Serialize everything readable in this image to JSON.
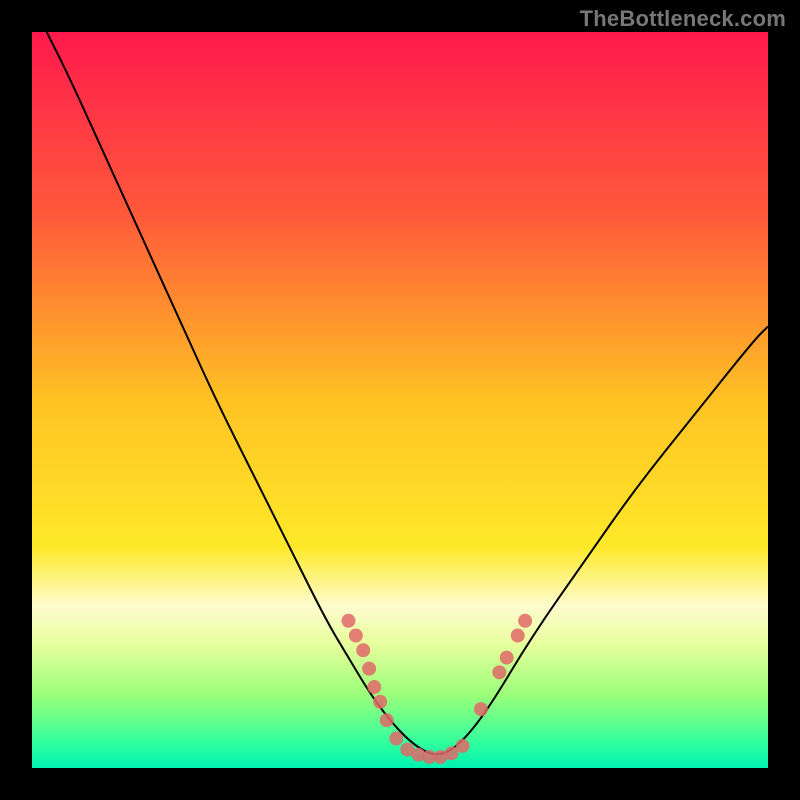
{
  "attribution": "TheBottleneck.com",
  "chart_data": {
    "type": "line",
    "title": "",
    "xlabel": "",
    "ylabel": "",
    "xlim": [
      0,
      100
    ],
    "ylim": [
      0,
      100
    ],
    "grid": false,
    "legend": false,
    "background_gradient": {
      "stops": [
        {
          "at": 0.0,
          "color": "#ff1a4d"
        },
        {
          "at": 0.25,
          "color": "#ff5a3a"
        },
        {
          "at": 0.5,
          "color": "#ffc224"
        },
        {
          "at": 0.7,
          "color": "#ffe92a"
        },
        {
          "at": 0.78,
          "color": "#fdfccf"
        },
        {
          "at": 0.83,
          "color": "#e9ff9e"
        },
        {
          "at": 0.9,
          "color": "#9cff7a"
        },
        {
          "at": 0.97,
          "color": "#2bffa0"
        },
        {
          "at": 1.0,
          "color": "#00f0b0"
        }
      ]
    },
    "series": [
      {
        "name": "bottleneck-curve",
        "color": "#000000",
        "x": [
          2,
          5,
          10,
          15,
          20,
          25,
          30,
          35,
          40,
          43,
          46,
          49,
          52,
          55,
          58,
          62,
          68,
          75,
          82,
          90,
          98,
          100
        ],
        "y": [
          100,
          94,
          83,
          72,
          61,
          50,
          40,
          30,
          20,
          15,
          10,
          6,
          3,
          1.5,
          3,
          8,
          18,
          28,
          38,
          48,
          58,
          60
        ]
      }
    ],
    "marker_groups": [
      {
        "name": "left-dots",
        "color": "#e06868",
        "points": [
          {
            "x": 43,
            "y": 20
          },
          {
            "x": 44,
            "y": 18
          },
          {
            "x": 45,
            "y": 16
          },
          {
            "x": 45.8,
            "y": 13.5
          },
          {
            "x": 46.5,
            "y": 11
          },
          {
            "x": 47.3,
            "y": 9
          },
          {
            "x": 48.2,
            "y": 6.5
          }
        ]
      },
      {
        "name": "bottom-dots",
        "color": "#e06868",
        "points": [
          {
            "x": 49.5,
            "y": 4
          },
          {
            "x": 51,
            "y": 2.5
          },
          {
            "x": 52.5,
            "y": 1.8
          },
          {
            "x": 54,
            "y": 1.5
          },
          {
            "x": 55.5,
            "y": 1.5
          },
          {
            "x": 57,
            "y": 2
          },
          {
            "x": 58.5,
            "y": 3
          }
        ]
      },
      {
        "name": "right-dots",
        "color": "#e06868",
        "points": [
          {
            "x": 61,
            "y": 8
          },
          {
            "x": 63.5,
            "y": 13
          },
          {
            "x": 64.5,
            "y": 15
          },
          {
            "x": 66,
            "y": 18
          },
          {
            "x": 67,
            "y": 20
          }
        ]
      }
    ]
  }
}
